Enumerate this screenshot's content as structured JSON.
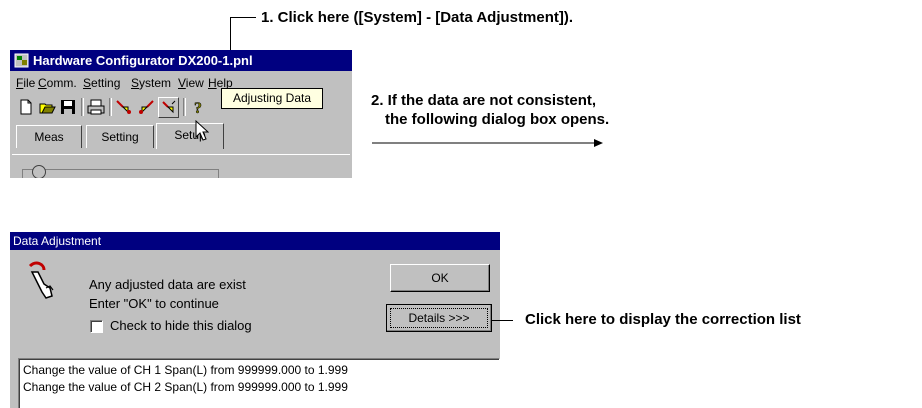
{
  "annotations": {
    "step1": "1. Click here ([System] - [Data Adjustment]).",
    "step2_line1": "2. If the data are not consistent,",
    "step2_line2": "the following dialog box opens.",
    "details_note": "Click here to display the correction list"
  },
  "app_window": {
    "title": "Hardware Configurator DX200-1.pnl",
    "menu": [
      "File",
      "Comm.",
      "Setting",
      "System",
      "View",
      "Help"
    ],
    "toolbar_icons": [
      "new-file-icon",
      "open-folder-icon",
      "save-icon",
      "print-icon",
      "send-data-icon",
      "receive-data-icon",
      "adjust-data-icon",
      "help-icon"
    ],
    "tabs": [
      "Meas",
      "Setting",
      "Setup"
    ],
    "tooltip": "Adjusting Data"
  },
  "dialog": {
    "title": "Data Adjustment",
    "message_line1": "Any adjusted data are exist",
    "message_line2": "Enter \"OK\" to continue",
    "checkbox_label": "Check to hide this dialog",
    "checkbox_checked": false,
    "ok_label": "OK",
    "details_label": "Details >>>",
    "list": [
      "Change the value of CH 1 Span(L) from 999999.000 to 1.999",
      "Change the value of CH 2 Span(L) from 999999.000 to 1.999"
    ]
  },
  "colors": {
    "titlebar": "#000080",
    "face": "#c0c0c0",
    "tooltip_bg": "#ffffe1"
  }
}
